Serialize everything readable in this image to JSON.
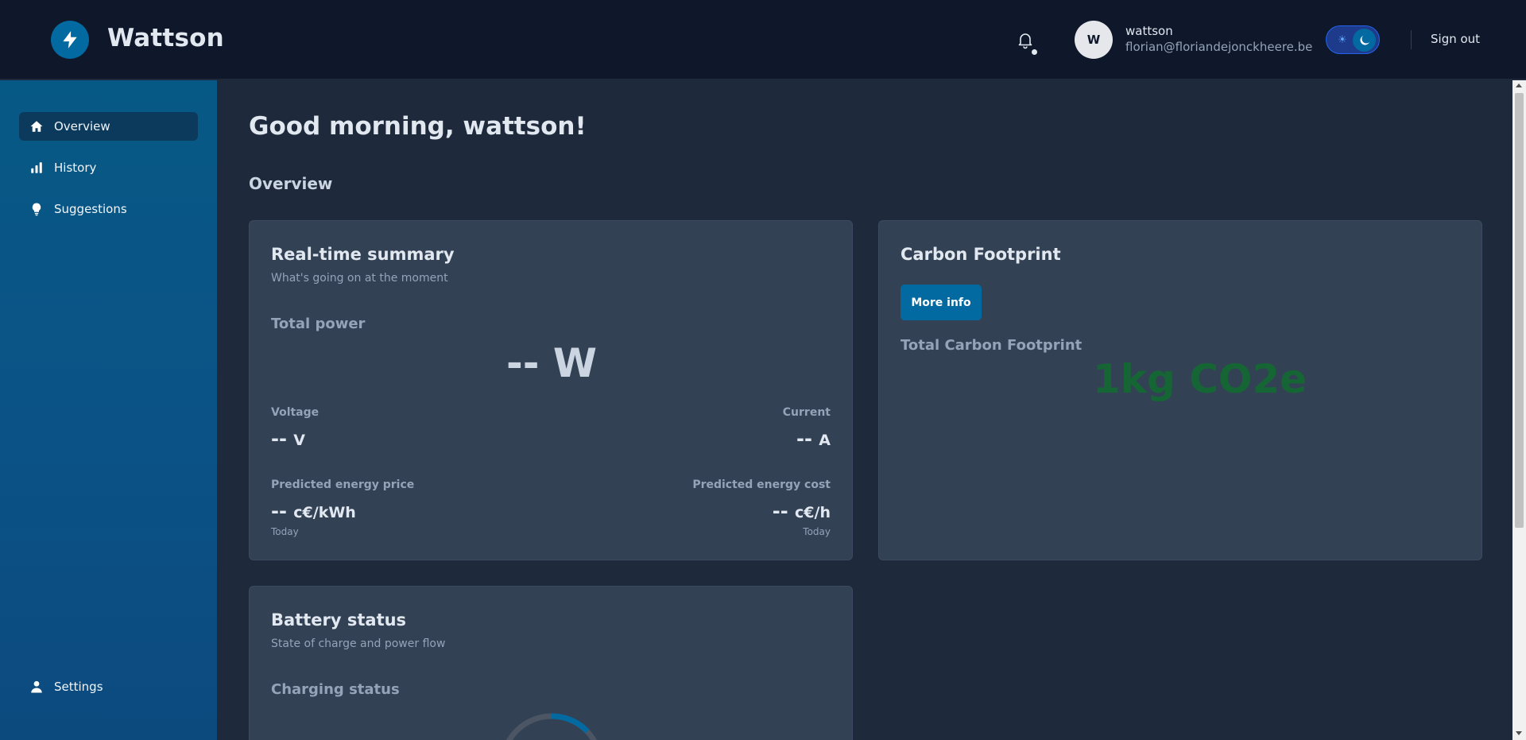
{
  "header": {
    "brand": "Wattson",
    "user": {
      "avatar_letter": "W",
      "name": "wattson",
      "email": "florian@floriandejonckheere.be"
    },
    "sign_out": "Sign out"
  },
  "sidebar": {
    "items": [
      {
        "label": "Overview",
        "icon": "home-icon",
        "active": true
      },
      {
        "label": "History",
        "icon": "bar-chart-icon",
        "active": false
      },
      {
        "label": "Suggestions",
        "icon": "lightbulb-icon",
        "active": false
      }
    ],
    "settings": {
      "label": "Settings",
      "icon": "user-icon"
    }
  },
  "main": {
    "greeting": "Good morning, wattson!",
    "section_title": "Overview",
    "realtime": {
      "title": "Real-time summary",
      "subtitle": "What's going on at the moment",
      "total_power_label": "Total power",
      "total_power_value": "-- W",
      "voltage_label": "Voltage",
      "voltage_value": "--",
      "voltage_unit": "V",
      "current_label": "Current",
      "current_value": "--",
      "current_unit": "A",
      "price_label": "Predicted energy price",
      "price_value": "--",
      "price_unit": "c€/kWh",
      "price_note": "Today",
      "cost_label": "Predicted energy cost",
      "cost_value": "--",
      "cost_unit": "c€/h",
      "cost_note": "Today"
    },
    "carbon": {
      "title": "Carbon Footprint",
      "more_info": "More info",
      "total_label": "Total Carbon Footprint",
      "total_value": "1kg CO2e"
    },
    "battery": {
      "title": "Battery status",
      "subtitle": "State of charge and power flow",
      "charging_label": "Charging status"
    }
  },
  "colors": {
    "header_bg": "#0f172a",
    "sidebar_bg": "#075985",
    "content_bg": "#1e293b",
    "card_bg": "#334155",
    "accent": "#0369a1",
    "carbon_value": "#166534"
  }
}
